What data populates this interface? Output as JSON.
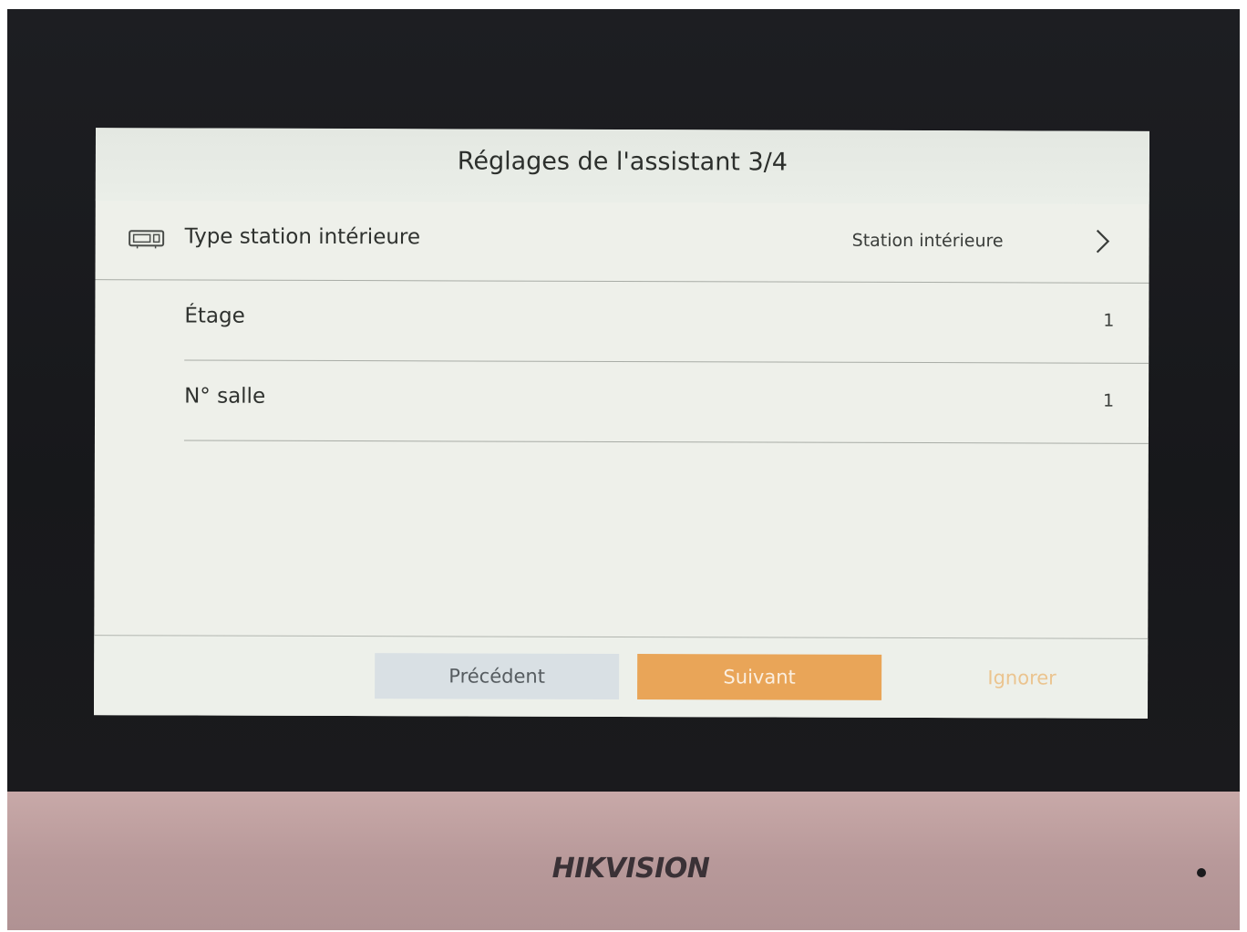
{
  "screen": {
    "title": "Réglages de l'assistant 3/4",
    "rows": [
      {
        "label": "Type station intérieure",
        "value": "Station intérieure"
      },
      {
        "label": "Étage",
        "value": "1"
      },
      {
        "label": "N° salle",
        "value": "1"
      }
    ],
    "buttons": {
      "previous": "Précédent",
      "next": "Suivant",
      "skip": "Ignorer"
    }
  },
  "device": {
    "brand": "HIKVISION"
  },
  "colors": {
    "accent": "#e9a558",
    "screen_bg": "#eef0ea",
    "bezel": "#1d1e22"
  },
  "icons": {
    "type_row": "indoor-station-icon",
    "type_row_action": "chevron-right-icon"
  }
}
